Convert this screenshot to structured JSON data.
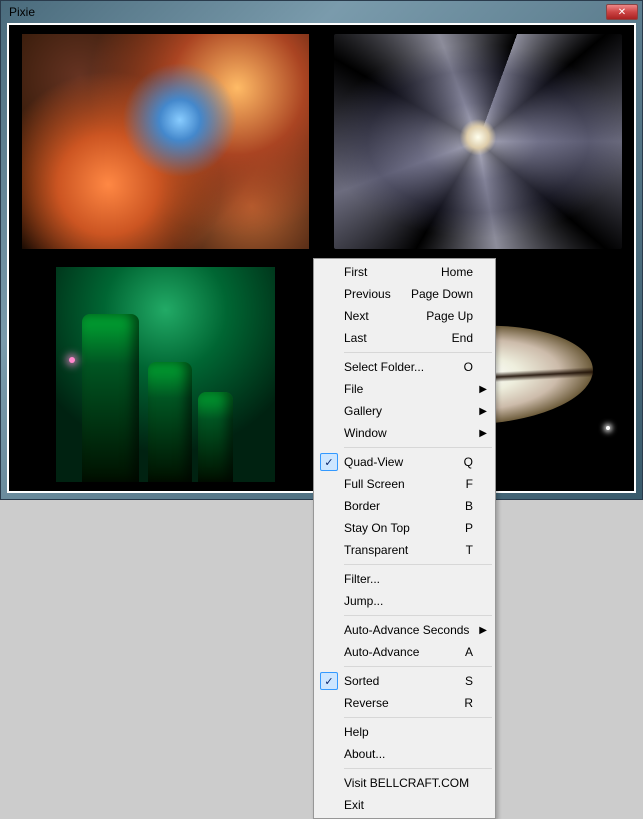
{
  "window": {
    "title": "Pixie"
  },
  "images": {
    "top_left_alt": "nebula",
    "top_right_alt": "spiral-galaxy",
    "bottom_left_alt": "pillars",
    "bottom_right_alt": "lenticular-galaxy"
  },
  "menu": {
    "groups": [
      [
        {
          "label": "First",
          "shortcut": "Home",
          "submenu": false,
          "checked": false
        },
        {
          "label": "Previous",
          "shortcut": "Page Down",
          "submenu": false,
          "checked": false
        },
        {
          "label": "Next",
          "shortcut": "Page Up",
          "submenu": false,
          "checked": false
        },
        {
          "label": "Last",
          "shortcut": "End",
          "submenu": false,
          "checked": false
        }
      ],
      [
        {
          "label": "Select Folder...",
          "shortcut": "O",
          "submenu": false,
          "checked": false
        },
        {
          "label": "File",
          "shortcut": "",
          "submenu": true,
          "checked": false
        },
        {
          "label": "Gallery",
          "shortcut": "",
          "submenu": true,
          "checked": false
        },
        {
          "label": "Window",
          "shortcut": "",
          "submenu": true,
          "checked": false
        }
      ],
      [
        {
          "label": "Quad-View",
          "shortcut": "Q",
          "submenu": false,
          "checked": true
        },
        {
          "label": "Full Screen",
          "shortcut": "F",
          "submenu": false,
          "checked": false
        },
        {
          "label": "Border",
          "shortcut": "B",
          "submenu": false,
          "checked": false
        },
        {
          "label": "Stay On Top",
          "shortcut": "P",
          "submenu": false,
          "checked": false
        },
        {
          "label": "Transparent",
          "shortcut": "T",
          "submenu": false,
          "checked": false
        }
      ],
      [
        {
          "label": "Filter...",
          "shortcut": "",
          "submenu": false,
          "checked": false
        },
        {
          "label": "Jump...",
          "shortcut": "",
          "submenu": false,
          "checked": false
        }
      ],
      [
        {
          "label": "Auto-Advance Seconds",
          "shortcut": "",
          "submenu": true,
          "checked": false
        },
        {
          "label": "Auto-Advance",
          "shortcut": "A",
          "submenu": false,
          "checked": false
        }
      ],
      [
        {
          "label": "Sorted",
          "shortcut": "S",
          "submenu": false,
          "checked": true
        },
        {
          "label": "Reverse",
          "shortcut": "R",
          "submenu": false,
          "checked": false
        }
      ],
      [
        {
          "label": "Help",
          "shortcut": "",
          "submenu": false,
          "checked": false
        },
        {
          "label": "About...",
          "shortcut": "",
          "submenu": false,
          "checked": false
        }
      ],
      [
        {
          "label": "Visit BELLCRAFT.COM",
          "shortcut": "",
          "submenu": false,
          "checked": false
        },
        {
          "label": "Exit",
          "shortcut": "",
          "submenu": false,
          "checked": false
        }
      ]
    ]
  }
}
